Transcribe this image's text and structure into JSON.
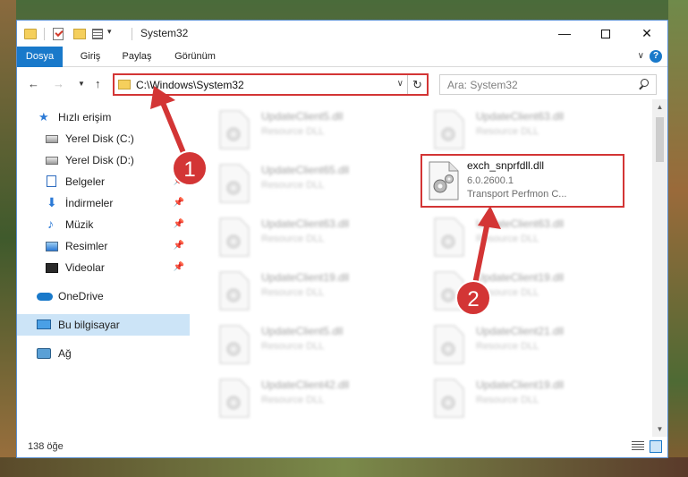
{
  "window": {
    "title": "System32",
    "minimize": "—",
    "close": "✕"
  },
  "ribbon": {
    "tabs": [
      "Dosya",
      "Giriş",
      "Paylaş",
      "Görünüm"
    ],
    "expand": "∨",
    "help": "?"
  },
  "nav": {
    "back": "←",
    "forward": "→",
    "recent": "▼",
    "up": "↑",
    "address": "C:\\Windows\\System32",
    "address_dropdown": "∨",
    "refresh": "↻",
    "search_placeholder": "Ara: System32"
  },
  "sidebar": {
    "items": [
      {
        "label": "Hızlı erişim",
        "icon": "star-icon",
        "pinned": false
      },
      {
        "label": "Yerel Disk (C:)",
        "icon": "drive-icon",
        "pinned": false
      },
      {
        "label": "Yerel Disk (D:)",
        "icon": "drive-icon",
        "pinned": false
      },
      {
        "label": "Belgeler",
        "icon": "documents-icon",
        "pinned": true
      },
      {
        "label": "İndirmeler",
        "icon": "download-icon",
        "pinned": true
      },
      {
        "label": "Müzik",
        "icon": "music-icon",
        "pinned": true
      },
      {
        "label": "Resimler",
        "icon": "pictures-icon",
        "pinned": true
      },
      {
        "label": "Videolar",
        "icon": "videos-icon",
        "pinned": true
      },
      {
        "label": "OneDrive",
        "icon": "cloud-icon",
        "pinned": false
      },
      {
        "label": "Bu bilgisayar",
        "icon": "computer-icon",
        "pinned": false
      },
      {
        "label": "Ağ",
        "icon": "network-icon",
        "pinned": false
      }
    ],
    "pin_glyph": "📌"
  },
  "files": {
    "left": [
      {
        "name": "UpdateClient5.dll",
        "type": "Resource DLL"
      },
      {
        "name": "UpdateClient65.dll",
        "type": "Resource DLL"
      },
      {
        "name": "UpdateClient63.dll",
        "type": "Resource DLL"
      },
      {
        "name": "UpdateClient19.dll",
        "type": "Resource DLL"
      },
      {
        "name": "UpdateClient5.dll",
        "type": "Resource DLL"
      },
      {
        "name": "UpdateClient42.dll",
        "type": "Resource DLL"
      }
    ],
    "right": [
      {
        "name": "UpdateClient63.dll",
        "type": "Resource DLL"
      },
      {
        "name": "exch_snprfdll.dll",
        "version": "6.0.2600.1",
        "description": "Transport Perfmon C..."
      },
      {
        "name": "UpdateClient63.dll",
        "type": "Resource DLL"
      },
      {
        "name": "UpdateClient19.dll",
        "type": "Resource DLL"
      },
      {
        "name": "UpdateClient21.dll",
        "type": "Resource DLL"
      },
      {
        "name": "UpdateClient19.dll",
        "type": "Resource DLL"
      }
    ]
  },
  "status": {
    "count": "138 öğe"
  },
  "annotations": {
    "step1": "1",
    "step2": "2",
    "color": "#d33535"
  },
  "colors": {
    "accent": "#1979ca",
    "selection": "#cce4f7",
    "highlight_border": "#d33535"
  }
}
